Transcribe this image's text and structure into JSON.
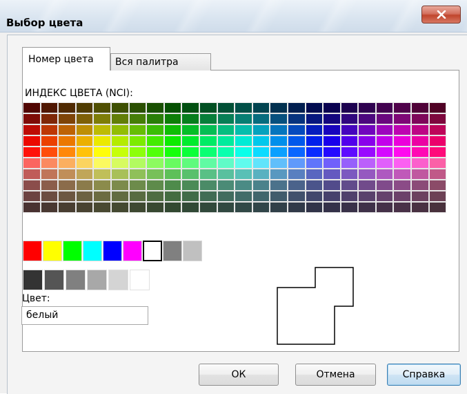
{
  "window": {
    "title": "Выбор цвета",
    "close_icon": "close-x-icon"
  },
  "tabs": [
    {
      "label": "Номер цвета",
      "active": true
    },
    {
      "label": "Вся палитра",
      "active": false
    }
  ],
  "palette": {
    "label": "ИНДЕКС ЦВЕТА (NCI):",
    "columns": 24,
    "rows": 10
  },
  "standard_colors": [
    "#ff0000",
    "#ffff00",
    "#00ff00",
    "#00ffff",
    "#0000ff",
    "#ff00ff",
    "#ffffff",
    "#808080",
    "#c0c0c0"
  ],
  "gray_colors": [
    "#333333",
    "#555555",
    "#808080",
    "#a8a8a8",
    "#d4d4d4",
    "#ffffff"
  ],
  "selected_color_index": 6,
  "color": {
    "label": "Цвет:",
    "value": "белый"
  },
  "buttons": {
    "ok": "ОК",
    "cancel": "Отмена",
    "help": "Справка"
  }
}
